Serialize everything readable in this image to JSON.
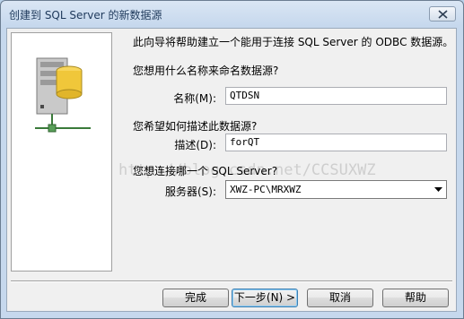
{
  "window": {
    "title": "创建到 SQL Server 的新数据源"
  },
  "content": {
    "intro": "此向导将帮助建立一个能用于连接 SQL Server 的 ODBC 数据源。",
    "name_question": "您想用什么名称来命名数据源?",
    "name_label": "名称(M):",
    "name_value": "QTDSN",
    "desc_question": "您希望如何描述此数据源?",
    "desc_label": "描述(D):",
    "desc_value": "forQT",
    "server_question": "您想连接哪一个 SQL Server?",
    "server_label": "服务器(S):",
    "server_value": "XWZ-PC\\MRXWZ",
    "watermark": "http://blog.csdn.net/CCSUXWZ"
  },
  "buttons": {
    "finish": "完成",
    "next": "下一步(N) >",
    "cancel": "取消",
    "help": "帮助"
  },
  "icons": {
    "title_close": "close-icon",
    "panel": "server-computer-icon",
    "dropdown": "chevron-down-icon"
  },
  "colors": {
    "title_bar": "#c6d8ed",
    "dialog_bg": "#f0f0f0",
    "default_button_border": "#3c7fb1"
  }
}
